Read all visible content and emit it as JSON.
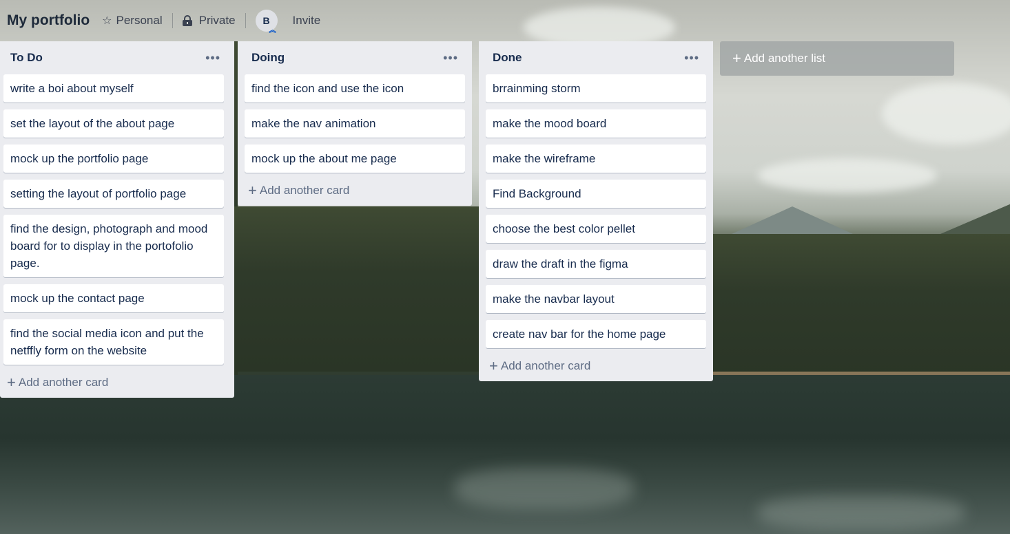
{
  "board": {
    "title": "My portfolio",
    "visibility_team": "Personal",
    "visibility": "Private",
    "member_initial": "B",
    "invite_label": "Invite"
  },
  "icons": {
    "star": "star-icon",
    "lock": "lock-icon",
    "menu": "more-icon",
    "plus": "plus-icon",
    "badge": "chevron-up-icon"
  },
  "lists": [
    {
      "title": "To Do",
      "cards": [
        "write a boi about myself",
        "set the layout of the about page",
        "mock up the portfolio page",
        "setting the layout of portfolio page",
        "find the design, photograph and mood board for to display in the portofolio page.",
        "mock up the contact page",
        "find the social media icon and put the netffly form on the website"
      ],
      "add_card_label": "Add another card"
    },
    {
      "title": "Doing",
      "cards": [
        "find the icon and use the icon",
        "make the nav animation",
        "mock up the about me page"
      ],
      "add_card_label": "Add another card"
    },
    {
      "title": "Done",
      "cards": [
        "brrainming storm",
        "make the mood board",
        "make the wireframe",
        "Find Background",
        "choose the best color pellet",
        "draw the draft in the figma",
        "make the navbar layout",
        "create nav bar for the home page"
      ],
      "add_card_label": "Add another card"
    }
  ],
  "add_list_label": "Add another list",
  "colors": {
    "list_bg": "#ebecf0",
    "card_bg": "#ffffff",
    "text": "#172b4d",
    "muted": "#5e6c84"
  }
}
